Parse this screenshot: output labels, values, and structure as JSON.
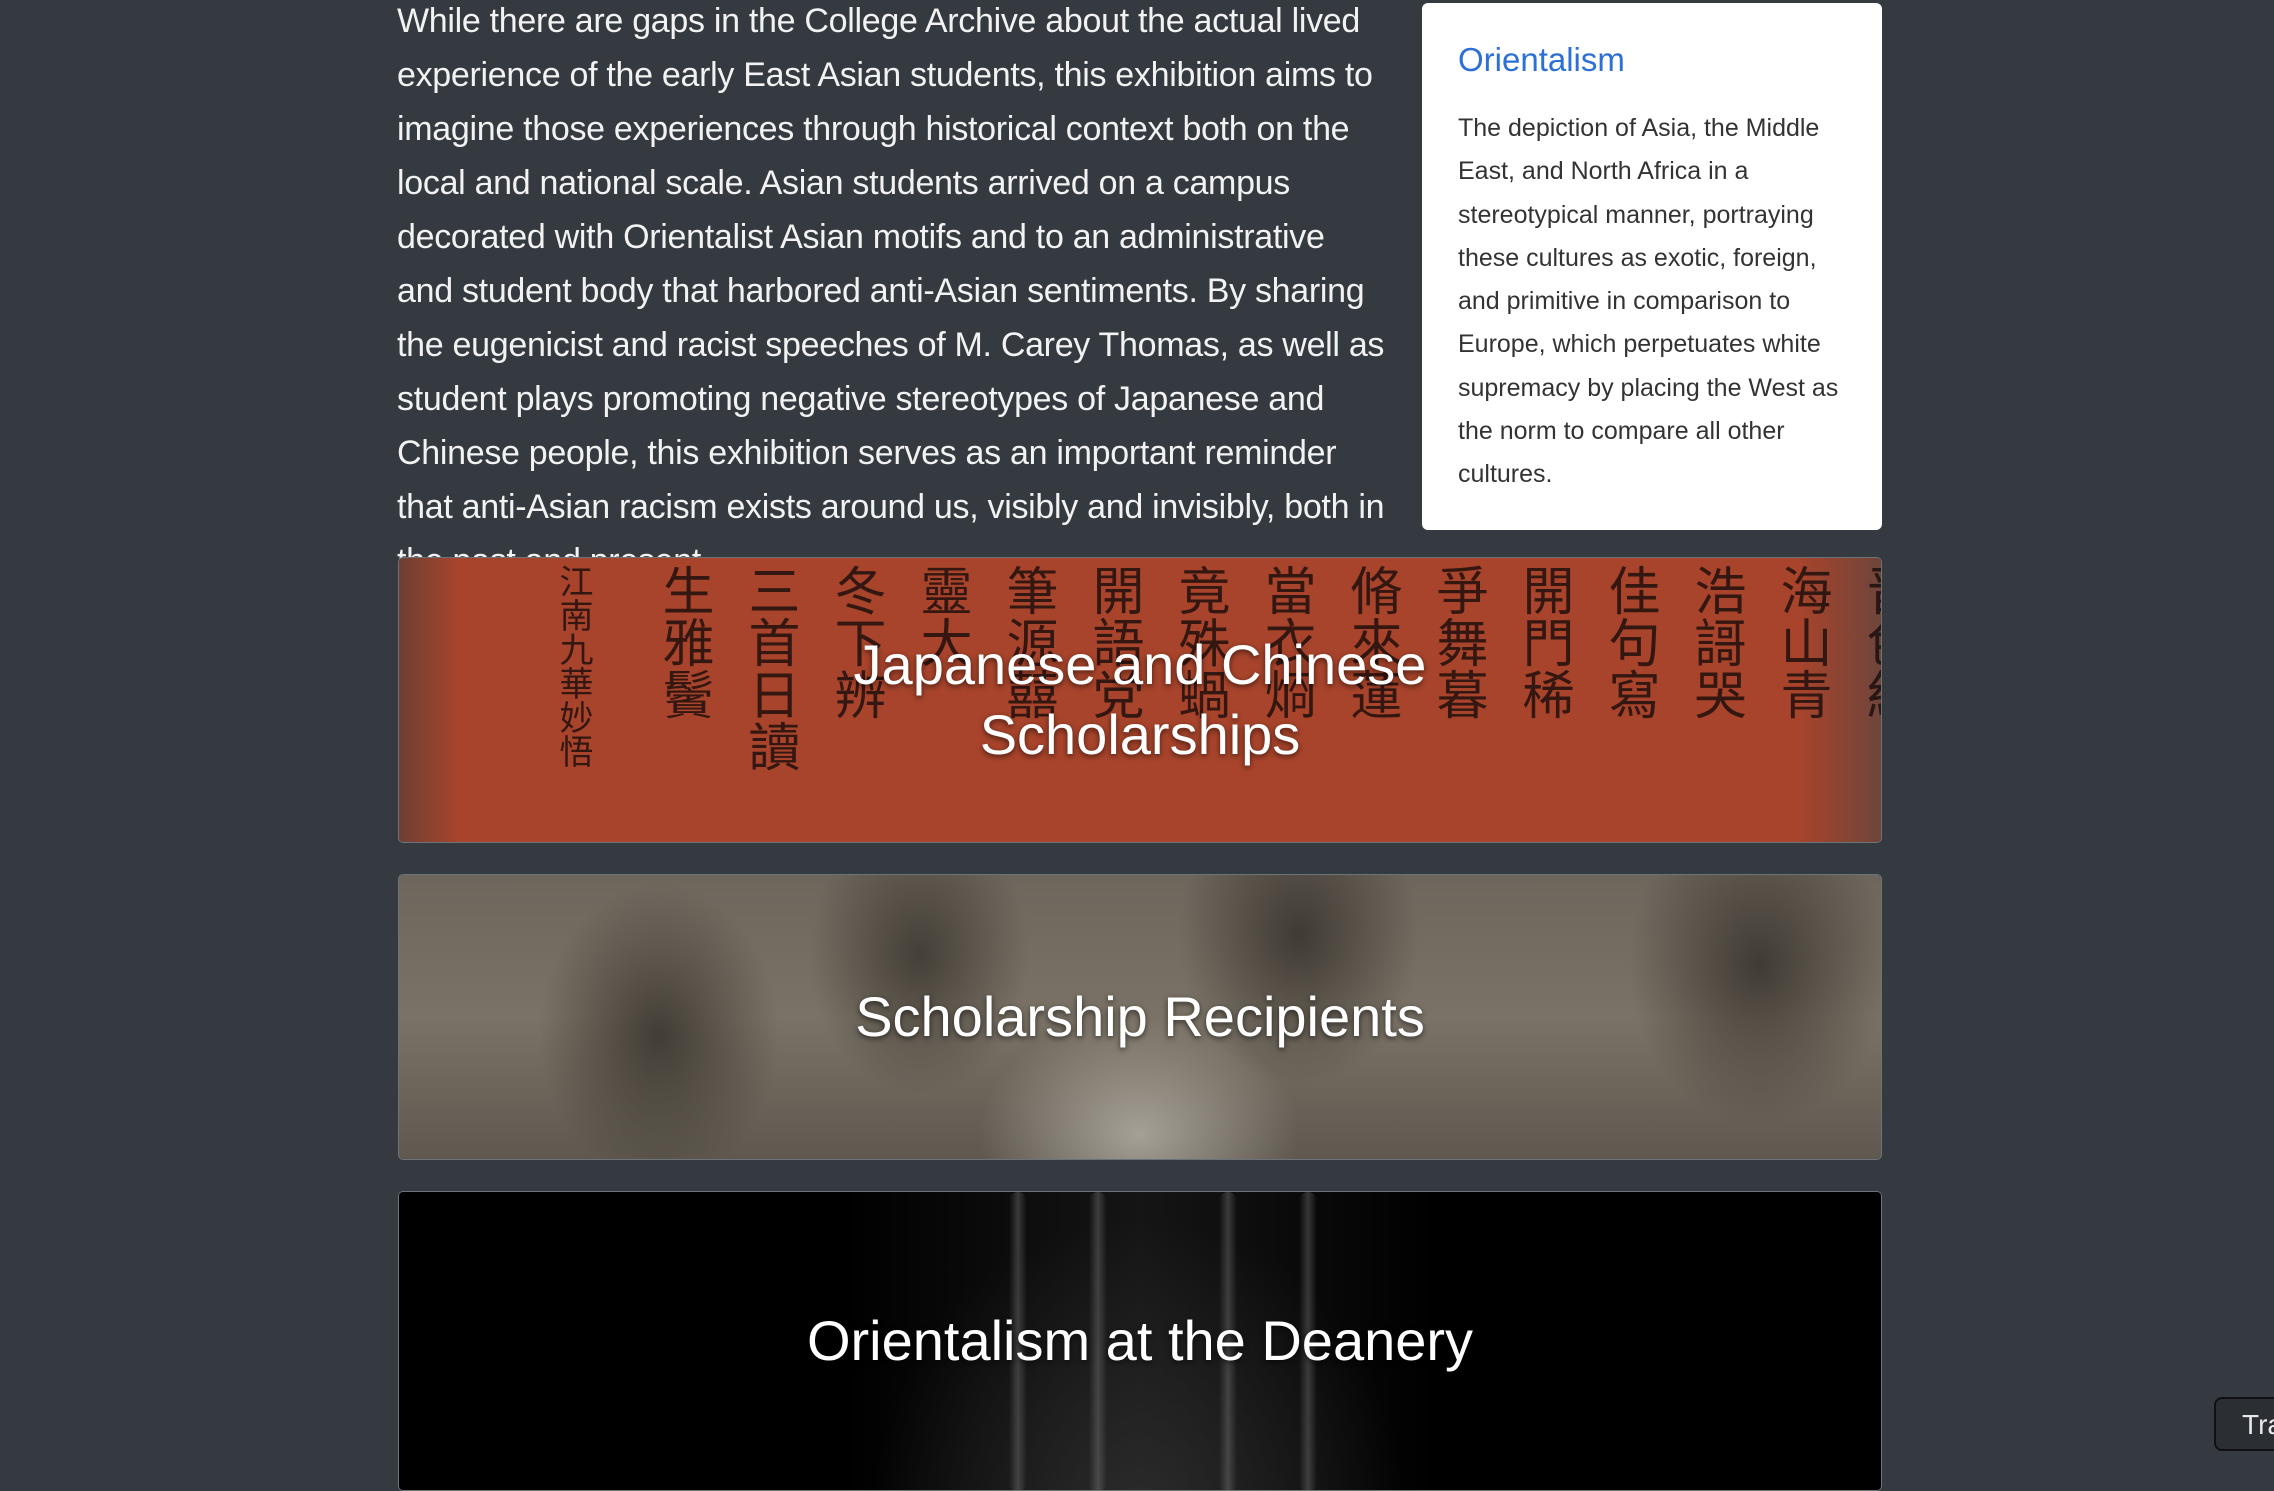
{
  "intro": {
    "text": "While there are gaps in the College Archive about the actual lived experience of the early East Asian students, this exhibition aims to imagine those experiences through historical context both on the local and national scale. Asian students arrived on a campus decorated with Orientalist Asian motifs and to an administrative and student body that harbored anti-Asian sentiments. By sharing the eugenicist and racist speeches of M. Carey Thomas, as well as student plays promoting negative stereotypes of Japanese and Chinese people, this exhibition serves as an important reminder that anti-Asian racism exists around us, visibly and invisibly, both in the past and present."
  },
  "glossary": {
    "term": "Orientalism",
    "definition": "The depiction of Asia, the Middle East, and North Africa in a stereotypical manner, portraying these cultures as exotic, foreign, and primitive in comparison to Europe, which perpetuates white supremacy by placing the West as the norm to compare all other cultures.",
    "accent_color": "#2c6fd6"
  },
  "cards": [
    {
      "title": "Japanese and Chinese Scholarships"
    },
    {
      "title": "Scholarship Recipients"
    },
    {
      "title": "Orientalism at the Deanery"
    }
  ],
  "translate_button": {
    "label": "Tra"
  },
  "scroll_art": {
    "columns": [
      "晋色紅",
      "海山青",
      "浩謌哭",
      "佳句寫",
      "開門稀",
      "爭舞暮",
      "脩來蓮",
      "當衣烱",
      "竟殊蝸",
      "開語党",
      "筆源囍",
      "靈大",
      "冬下辨",
      "三首日讀",
      "生雅鬢",
      "江南九華妙悟"
    ]
  },
  "colors": {
    "page_background": "#343a40",
    "card_text": "#ffffff"
  }
}
